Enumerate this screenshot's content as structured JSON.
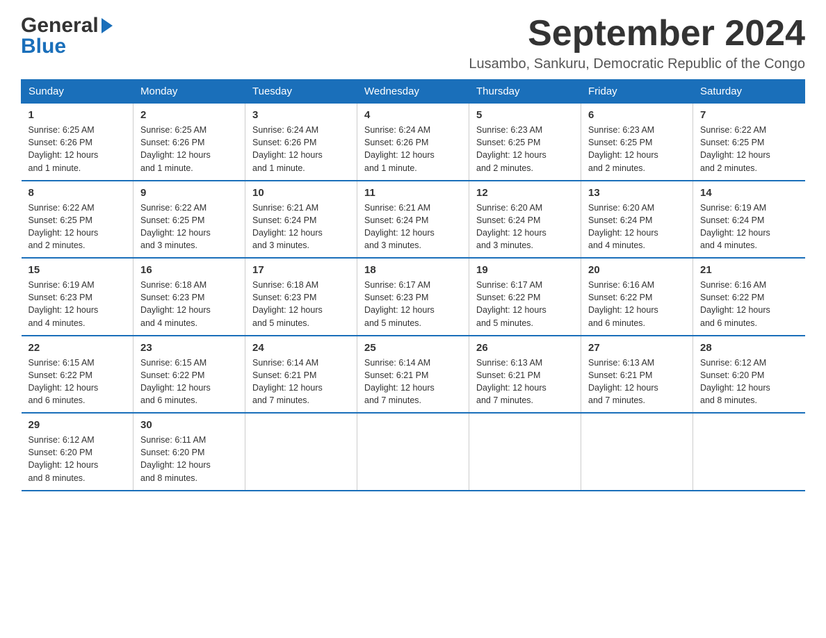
{
  "logo": {
    "part1": "General",
    "part2": "Blue"
  },
  "title": "September 2024",
  "location": "Lusambo, Sankuru, Democratic Republic of the Congo",
  "days_of_week": [
    "Sunday",
    "Monday",
    "Tuesday",
    "Wednesday",
    "Thursday",
    "Friday",
    "Saturday"
  ],
  "weeks": [
    [
      {
        "day": "1",
        "info": "Sunrise: 6:25 AM\nSunset: 6:26 PM\nDaylight: 12 hours\nand 1 minute."
      },
      {
        "day": "2",
        "info": "Sunrise: 6:25 AM\nSunset: 6:26 PM\nDaylight: 12 hours\nand 1 minute."
      },
      {
        "day": "3",
        "info": "Sunrise: 6:24 AM\nSunset: 6:26 PM\nDaylight: 12 hours\nand 1 minute."
      },
      {
        "day": "4",
        "info": "Sunrise: 6:24 AM\nSunset: 6:26 PM\nDaylight: 12 hours\nand 1 minute."
      },
      {
        "day": "5",
        "info": "Sunrise: 6:23 AM\nSunset: 6:25 PM\nDaylight: 12 hours\nand 2 minutes."
      },
      {
        "day": "6",
        "info": "Sunrise: 6:23 AM\nSunset: 6:25 PM\nDaylight: 12 hours\nand 2 minutes."
      },
      {
        "day": "7",
        "info": "Sunrise: 6:22 AM\nSunset: 6:25 PM\nDaylight: 12 hours\nand 2 minutes."
      }
    ],
    [
      {
        "day": "8",
        "info": "Sunrise: 6:22 AM\nSunset: 6:25 PM\nDaylight: 12 hours\nand 2 minutes."
      },
      {
        "day": "9",
        "info": "Sunrise: 6:22 AM\nSunset: 6:25 PM\nDaylight: 12 hours\nand 3 minutes."
      },
      {
        "day": "10",
        "info": "Sunrise: 6:21 AM\nSunset: 6:24 PM\nDaylight: 12 hours\nand 3 minutes."
      },
      {
        "day": "11",
        "info": "Sunrise: 6:21 AM\nSunset: 6:24 PM\nDaylight: 12 hours\nand 3 minutes."
      },
      {
        "day": "12",
        "info": "Sunrise: 6:20 AM\nSunset: 6:24 PM\nDaylight: 12 hours\nand 3 minutes."
      },
      {
        "day": "13",
        "info": "Sunrise: 6:20 AM\nSunset: 6:24 PM\nDaylight: 12 hours\nand 4 minutes."
      },
      {
        "day": "14",
        "info": "Sunrise: 6:19 AM\nSunset: 6:24 PM\nDaylight: 12 hours\nand 4 minutes."
      }
    ],
    [
      {
        "day": "15",
        "info": "Sunrise: 6:19 AM\nSunset: 6:23 PM\nDaylight: 12 hours\nand 4 minutes."
      },
      {
        "day": "16",
        "info": "Sunrise: 6:18 AM\nSunset: 6:23 PM\nDaylight: 12 hours\nand 4 minutes."
      },
      {
        "day": "17",
        "info": "Sunrise: 6:18 AM\nSunset: 6:23 PM\nDaylight: 12 hours\nand 5 minutes."
      },
      {
        "day": "18",
        "info": "Sunrise: 6:17 AM\nSunset: 6:23 PM\nDaylight: 12 hours\nand 5 minutes."
      },
      {
        "day": "19",
        "info": "Sunrise: 6:17 AM\nSunset: 6:22 PM\nDaylight: 12 hours\nand 5 minutes."
      },
      {
        "day": "20",
        "info": "Sunrise: 6:16 AM\nSunset: 6:22 PM\nDaylight: 12 hours\nand 6 minutes."
      },
      {
        "day": "21",
        "info": "Sunrise: 6:16 AM\nSunset: 6:22 PM\nDaylight: 12 hours\nand 6 minutes."
      }
    ],
    [
      {
        "day": "22",
        "info": "Sunrise: 6:15 AM\nSunset: 6:22 PM\nDaylight: 12 hours\nand 6 minutes."
      },
      {
        "day": "23",
        "info": "Sunrise: 6:15 AM\nSunset: 6:22 PM\nDaylight: 12 hours\nand 6 minutes."
      },
      {
        "day": "24",
        "info": "Sunrise: 6:14 AM\nSunset: 6:21 PM\nDaylight: 12 hours\nand 7 minutes."
      },
      {
        "day": "25",
        "info": "Sunrise: 6:14 AM\nSunset: 6:21 PM\nDaylight: 12 hours\nand 7 minutes."
      },
      {
        "day": "26",
        "info": "Sunrise: 6:13 AM\nSunset: 6:21 PM\nDaylight: 12 hours\nand 7 minutes."
      },
      {
        "day": "27",
        "info": "Sunrise: 6:13 AM\nSunset: 6:21 PM\nDaylight: 12 hours\nand 7 minutes."
      },
      {
        "day": "28",
        "info": "Sunrise: 6:12 AM\nSunset: 6:20 PM\nDaylight: 12 hours\nand 8 minutes."
      }
    ],
    [
      {
        "day": "29",
        "info": "Sunrise: 6:12 AM\nSunset: 6:20 PM\nDaylight: 12 hours\nand 8 minutes."
      },
      {
        "day": "30",
        "info": "Sunrise: 6:11 AM\nSunset: 6:20 PM\nDaylight: 12 hours\nand 8 minutes."
      },
      {
        "day": "",
        "info": ""
      },
      {
        "day": "",
        "info": ""
      },
      {
        "day": "",
        "info": ""
      },
      {
        "day": "",
        "info": ""
      },
      {
        "day": "",
        "info": ""
      }
    ]
  ]
}
